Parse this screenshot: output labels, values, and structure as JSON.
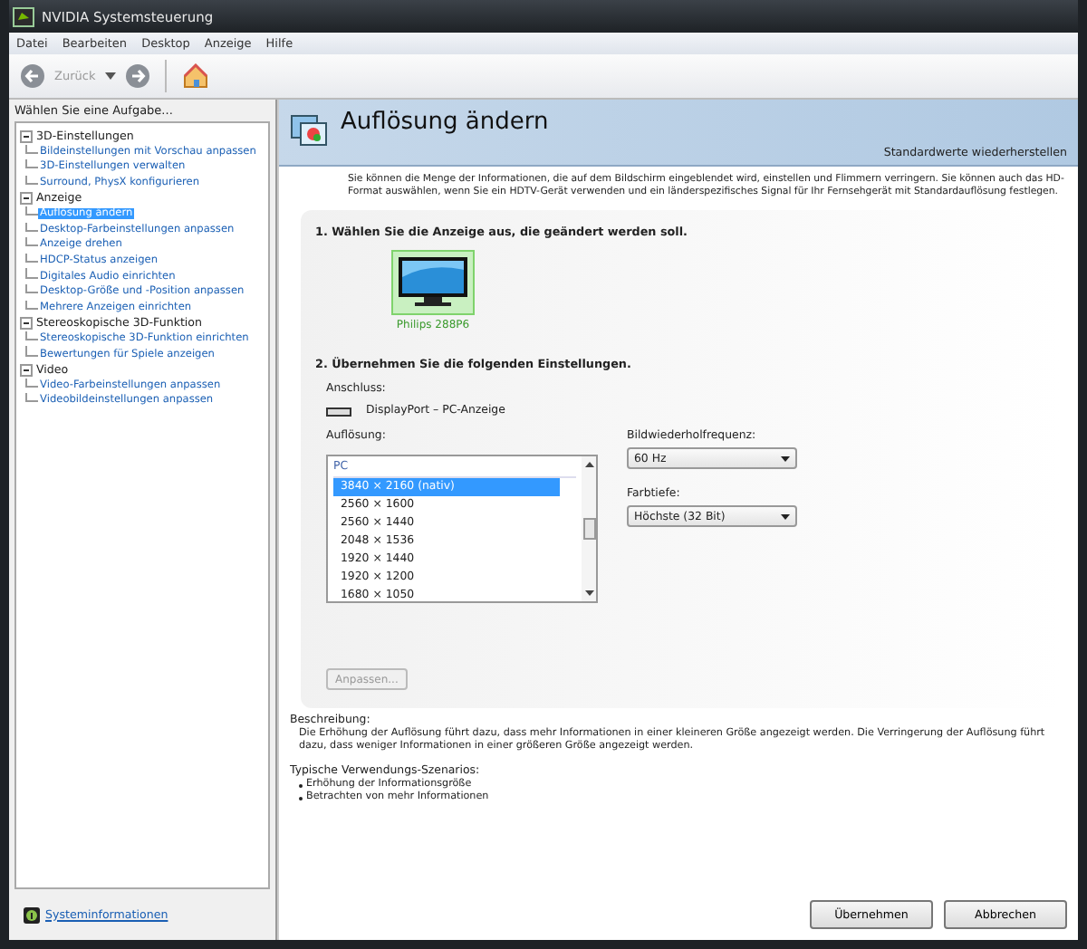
{
  "window": {
    "title": "NVIDIA Systemsteuerung"
  },
  "menu": [
    "Datei",
    "Bearbeiten",
    "Desktop",
    "Anzeige",
    "Hilfe"
  ],
  "toolbar": {
    "back_label": "Zurück"
  },
  "sidebar": {
    "heading": "Wählen Sie eine Aufgabe...",
    "tree": [
      {
        "label": "3D-Einstellungen",
        "expanded": true,
        "children": [
          {
            "label": "Bildeinstellungen mit Vorschau anpassen",
            "selected": false
          },
          {
            "label": "3D-Einstellungen verwalten",
            "selected": false
          },
          {
            "label": "Surround, PhysX konfigurieren",
            "selected": false
          }
        ]
      },
      {
        "label": "Anzeige",
        "expanded": true,
        "children": [
          {
            "label": "Auflösung ändern",
            "selected": true
          },
          {
            "label": "Desktop-Farbeinstellungen anpassen",
            "selected": false
          },
          {
            "label": "Anzeige drehen",
            "selected": false
          },
          {
            "label": "HDCP-Status anzeigen",
            "selected": false
          },
          {
            "label": "Digitales Audio einrichten",
            "selected": false
          },
          {
            "label": "Desktop-Größe und -Position anpassen",
            "selected": false
          },
          {
            "label": "Mehrere Anzeigen einrichten",
            "selected": false
          }
        ]
      },
      {
        "label": "Stereoskopische 3D-Funktion",
        "expanded": true,
        "children": [
          {
            "label": "Stereoskopische 3D-Funktion einrichten",
            "selected": false
          },
          {
            "label": "Bewertungen für Spiele anzeigen",
            "selected": false
          }
        ]
      },
      {
        "label": "Video",
        "expanded": true,
        "children": [
          {
            "label": "Video-Farbeinstellungen anpassen",
            "selected": false
          },
          {
            "label": "Videobildeinstellungen anpassen",
            "selected": false
          }
        ]
      }
    ],
    "footer_link": "Systeminformationen"
  },
  "page": {
    "title": "Auflösung ändern",
    "restore_link": "Standardwerte wiederherstellen",
    "intro": "Sie können die Menge der Informationen, die auf dem Bildschirm eingeblendet wird, einstellen und Flimmern verringern. Sie können auch das HD-Format auswählen, wenn Sie ein HDTV-Gerät verwenden und ein länderspezifisches Signal für Ihr Fernsehgerät mit Standardauflösung festlegen.",
    "step1": "1. Wählen Sie die Anzeige aus, die geändert werden soll.",
    "displays": [
      {
        "label": "Philips 288P6",
        "selected": true
      }
    ],
    "step2": "2. Übernehmen Sie die folgenden Einstellungen.",
    "connection_label": "Anschluss:",
    "connection_value": "DisplayPort – PC-Anzeige",
    "resolution_label": "Auflösung:",
    "resolution_group": "PC",
    "resolutions": [
      {
        "label": "3840 × 2160 (nativ)",
        "selected": true
      },
      {
        "label": "2560 × 1600",
        "selected": false
      },
      {
        "label": "2560 × 1440",
        "selected": false
      },
      {
        "label": "2048 × 1536",
        "selected": false
      },
      {
        "label": "1920 × 1440",
        "selected": false
      },
      {
        "label": "1920 × 1200",
        "selected": false
      },
      {
        "label": "1680 × 1050",
        "selected": false
      }
    ],
    "refresh_label": "Bildwiederholfrequenz:",
    "refresh_value": "60 Hz",
    "depth_label": "Farbtiefe:",
    "depth_value": "Höchste (32 Bit)",
    "customize_button": {
      "label": "Anpassen...",
      "disabled": true
    },
    "description_label": "Beschreibung:",
    "description": "Die Erhöhung der Auflösung führt dazu, dass mehr Informationen in einer kleineren Größe angezeigt werden. Die Verringerung der Auflösung führt dazu, dass weniger Informationen in einer größeren Größe angezeigt werden.",
    "scenarios_label": "Typische Verwendungs-Szenarios:",
    "scenarios": [
      "Erhöhung der Informationsgröße",
      "Betrachten von mehr Informationen"
    ]
  },
  "buttons": [
    "Übernehmen",
    "Abbrechen"
  ]
}
